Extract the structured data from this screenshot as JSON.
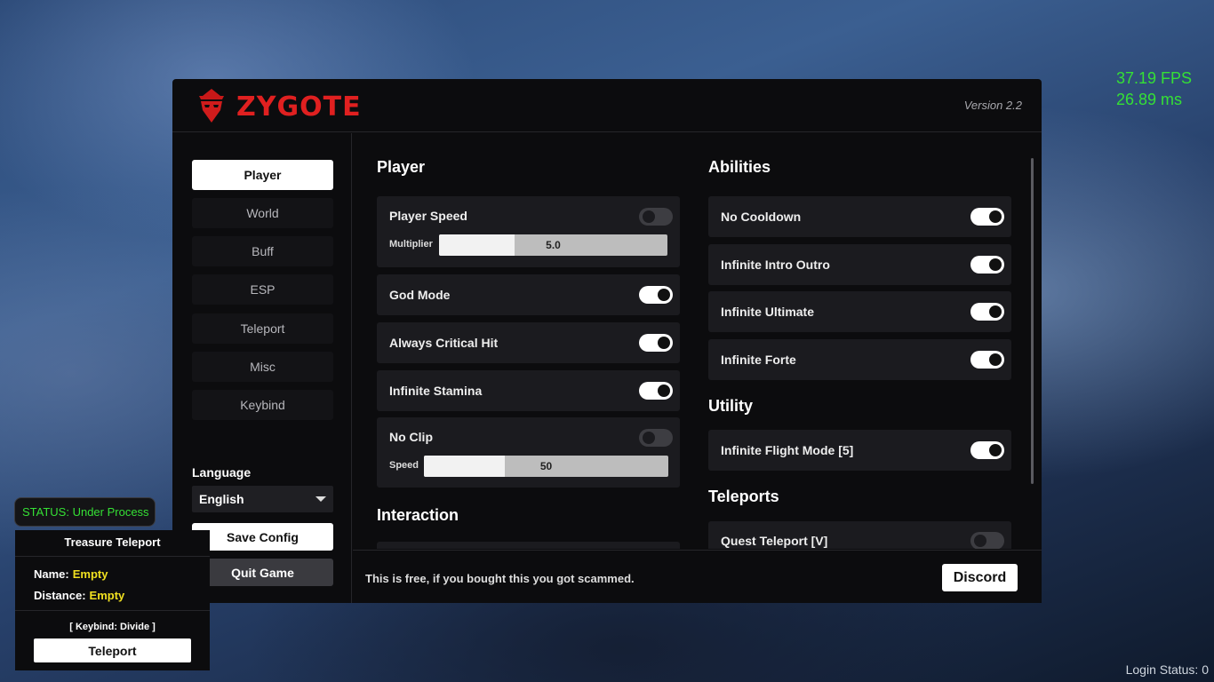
{
  "overlay": {
    "fps": "37.19 FPS",
    "latency": "26.89 ms",
    "login_status": "Login Status: 0"
  },
  "header": {
    "brand": "ZYGOTE",
    "version": "Version 2.2",
    "accent": "#e02020"
  },
  "sidebar": {
    "items": [
      {
        "label": "Player",
        "active": true
      },
      {
        "label": "World"
      },
      {
        "label": "Buff"
      },
      {
        "label": "ESP"
      },
      {
        "label": "Teleport"
      },
      {
        "label": "Misc"
      },
      {
        "label": "Keybind"
      }
    ],
    "language_label": "Language",
    "language_value": "English",
    "save_label": "Save Config",
    "quit_label": "Quit Game"
  },
  "player": {
    "title": "Player",
    "speed_label": "Player Speed",
    "speed_toggle": false,
    "multiplier_label": "Multiplier",
    "multiplier_value": "5.0",
    "multiplier_fill": 0.33,
    "god_mode": "God Mode",
    "critical": "Always Critical Hit",
    "stamina": "Infinite Stamina",
    "noclip_label": "No Clip",
    "noclip_toggle": false,
    "noclip_speed_label": "Speed",
    "noclip_speed_value": "50",
    "noclip_speed_fill": 0.33
  },
  "interaction": {
    "title": "Interaction"
  },
  "abilities": {
    "title": "Abilities",
    "items": [
      "No Cooldown",
      "Infinite Intro Outro",
      "Infinite Ultimate",
      "Infinite Forte"
    ]
  },
  "utility": {
    "title": "Utility",
    "flight": "Infinite Flight Mode [5]"
  },
  "teleports": {
    "title": "Teleports",
    "quest": "Quest Teleport [V]"
  },
  "footer": {
    "notice": "This is free, if you bought this you got scammed.",
    "discord": "Discord"
  },
  "status": {
    "text": "STATUS: Under Process",
    "color": "#35e035"
  },
  "treasure": {
    "title": "Treasure Teleport",
    "name_label": "Name:",
    "name_value": "Empty",
    "distance_label": "Distance:",
    "distance_value": "Empty",
    "keybind": "[ Keybind: Divide ]",
    "button": "Teleport"
  }
}
